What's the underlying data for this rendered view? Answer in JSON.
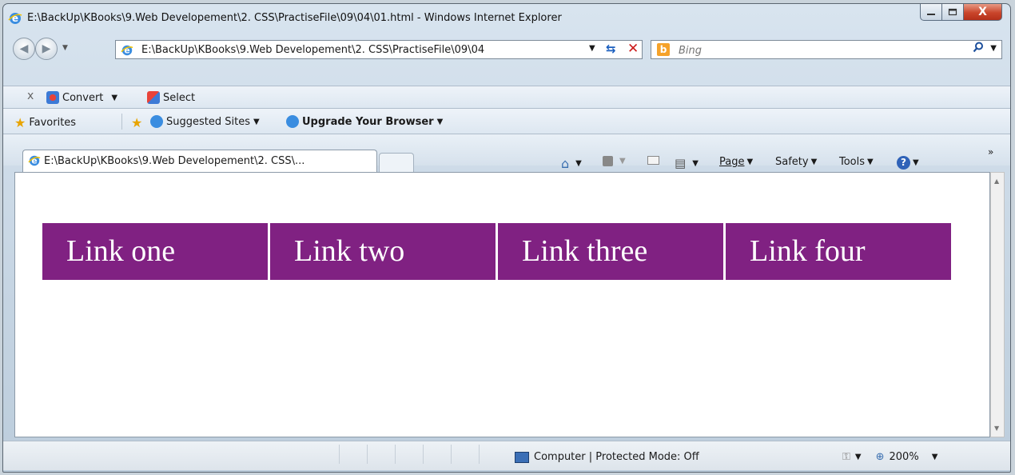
{
  "window": {
    "title": "E:\\BackUp\\KBooks\\9.Web Developement\\2. CSS\\PractiseFile\\09\\04\\01.html - Windows Internet Explorer",
    "close_glyph": "X"
  },
  "nav": {
    "address": "E:\\BackUp\\KBooks\\9.Web Developement\\2. CSS\\PractiseFile\\09\\04",
    "search_placeholder": "Bing"
  },
  "toolbar": {
    "close_glyph": "x",
    "convert_label": "Convert",
    "select_label": "Select"
  },
  "favorites": {
    "favorites_label": "Favorites",
    "suggested_sites_label": "Suggested Sites",
    "upgrade_label": "Upgrade Your Browser"
  },
  "tabs": {
    "active_title": "E:\\BackUp\\KBooks\\9.Web Developement\\2. CSS\\..."
  },
  "commands": {
    "page_label": "Page",
    "safety_label": "Safety",
    "tools_label": "Tools",
    "chevron": "»"
  },
  "page": {
    "menu": [
      "Link one",
      "Link two",
      "Link three",
      "Link four"
    ],
    "menu_bg": "#802182",
    "menu_fg": "#ffffff"
  },
  "status": {
    "zone_text": "Computer | Protected Mode: Off",
    "zoom_text": "200%"
  },
  "icons": [
    "ie-icon",
    "back-arrow-icon",
    "forward-arrow-icon",
    "refresh-icon",
    "stop-icon",
    "bing-icon",
    "search-icon",
    "convert-icon",
    "select-icon",
    "star-icon",
    "add-favorites-icon",
    "home-icon",
    "feeds-icon",
    "mail-icon",
    "print-icon",
    "help-icon",
    "computer-icon",
    "security-icon",
    "zoom-icon"
  ]
}
